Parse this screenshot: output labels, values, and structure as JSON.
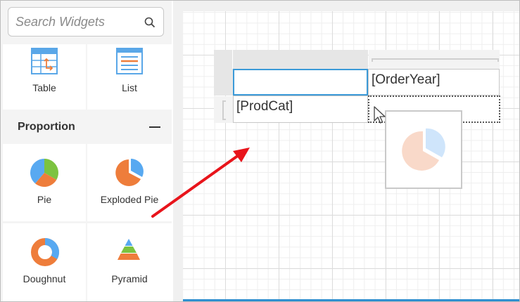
{
  "search": {
    "placeholder": "Search Widgets",
    "icon": "search-icon"
  },
  "widgets": {
    "table_label": "Table",
    "list_label": "List"
  },
  "proportion": {
    "title": "Proportion",
    "items": [
      {
        "label": "Pie"
      },
      {
        "label": "Exploded Pie"
      },
      {
        "label": "Doughnut"
      },
      {
        "label": "Pyramid"
      }
    ]
  },
  "matrix": {
    "column_field": "[OrderYear]",
    "row_field": "[ProdCat]"
  },
  "colors": {
    "accent_blue": "#2e8fd0",
    "pie_blue": "#58a9f1",
    "pie_green": "#7cc340",
    "pie_orange": "#ee7d3b",
    "arrow_red": "#e8141b"
  }
}
